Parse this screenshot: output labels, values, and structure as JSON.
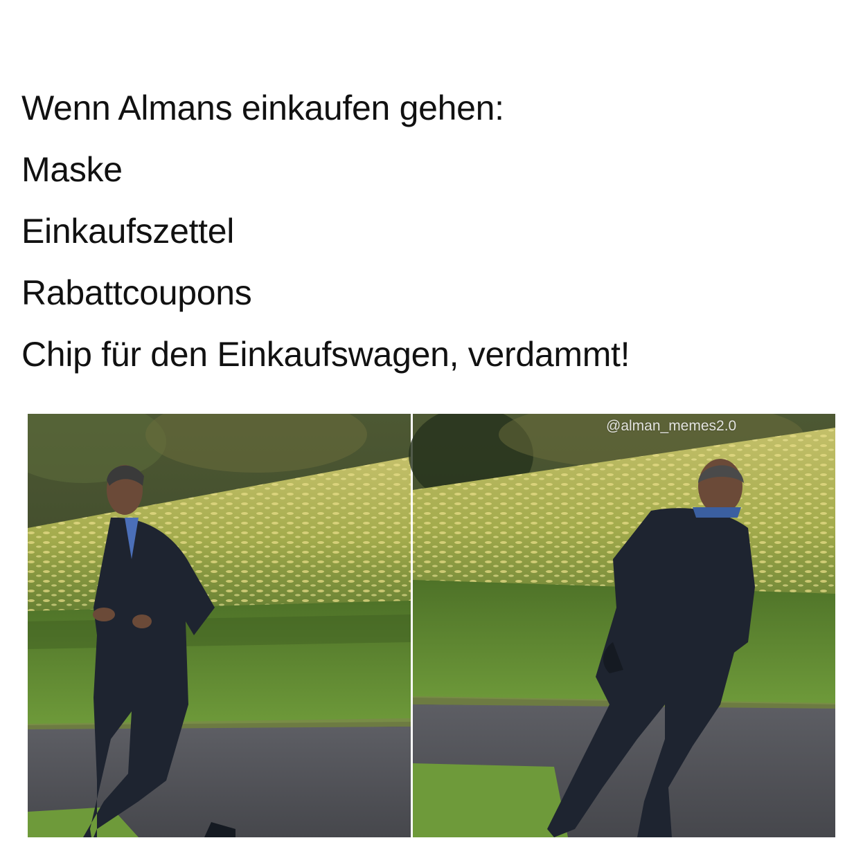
{
  "caption": {
    "lines": [
      "Wenn Almans einkaufen gehen:",
      "Maske",
      "Einkaufszettel",
      "Rabattcoupons",
      "Chip für den Einkaufswagen, verdammt!"
    ]
  },
  "photos": {
    "watermark": "@alman_memes2.0",
    "panels": [
      {
        "subject": "man-in-suit-running-sideways"
      },
      {
        "subject": "man-in-suit-running-away"
      }
    ]
  },
  "colors": {
    "background": "#ffffff",
    "text": "#111111",
    "lawn": "#5f8a32",
    "hedge": "#b7b65a",
    "path": "#55565c",
    "suit": "#1e2430",
    "trees": "#3f4a2b"
  }
}
